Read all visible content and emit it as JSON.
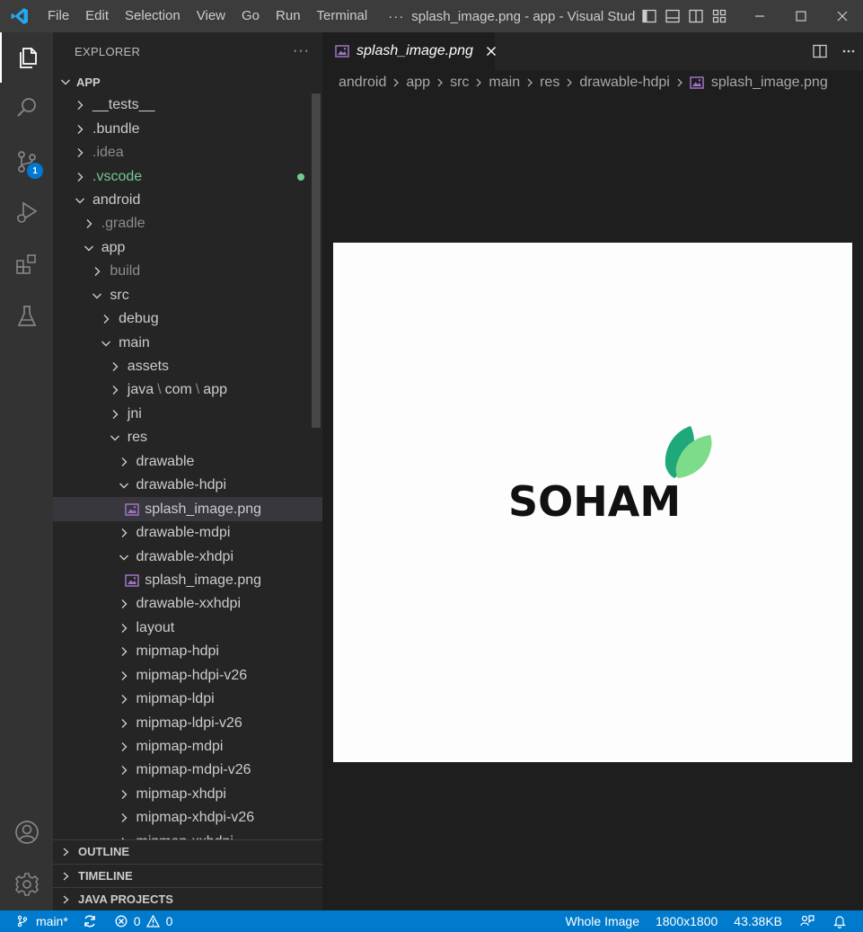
{
  "titlebar": {
    "menu": [
      "File",
      "Edit",
      "Selection",
      "View",
      "Go",
      "Run",
      "Terminal"
    ],
    "more": "···",
    "title": "splash_image.png - app - Visual Studi..."
  },
  "activity": {
    "scm_badge": "1"
  },
  "sidebar": {
    "header": "EXPLORER",
    "header_more": "···",
    "root": "APP",
    "tree": [
      {
        "label": "__tests__",
        "depth": 0,
        "type": "folder",
        "open": false
      },
      {
        "label": ".bundle",
        "depth": 0,
        "type": "folder",
        "open": false
      },
      {
        "label": ".idea",
        "depth": 0,
        "type": "folder",
        "open": false,
        "dim": true
      },
      {
        "label": ".vscode",
        "depth": 0,
        "type": "folder",
        "open": false,
        "git": true
      },
      {
        "label": "android",
        "depth": 0,
        "type": "folder",
        "open": true
      },
      {
        "label": ".gradle",
        "depth": 1,
        "type": "folder",
        "open": false,
        "dim": true
      },
      {
        "label": "app",
        "depth": 1,
        "type": "folder",
        "open": true
      },
      {
        "label": "build",
        "depth": 2,
        "type": "folder",
        "open": false,
        "dim": true
      },
      {
        "label": "src",
        "depth": 2,
        "type": "folder",
        "open": true
      },
      {
        "label": "debug",
        "depth": 3,
        "type": "folder",
        "open": false
      },
      {
        "label": "main",
        "depth": 3,
        "type": "folder",
        "open": true
      },
      {
        "label": "assets",
        "depth": 4,
        "type": "folder",
        "open": false
      },
      {
        "label": "java",
        "compact": [
          "com",
          "app"
        ],
        "depth": 4,
        "type": "folder",
        "open": false
      },
      {
        "label": "jni",
        "depth": 4,
        "type": "folder",
        "open": false
      },
      {
        "label": "res",
        "depth": 4,
        "type": "folder",
        "open": true
      },
      {
        "label": "drawable",
        "depth": 5,
        "type": "folder",
        "open": false
      },
      {
        "label": "drawable-hdpi",
        "depth": 5,
        "type": "folder",
        "open": true
      },
      {
        "label": "splash_image.png",
        "depth": 6,
        "type": "image",
        "selected": true
      },
      {
        "label": "drawable-mdpi",
        "depth": 5,
        "type": "folder",
        "open": false
      },
      {
        "label": "drawable-xhdpi",
        "depth": 5,
        "type": "folder",
        "open": true
      },
      {
        "label": "splash_image.png",
        "depth": 6,
        "type": "image"
      },
      {
        "label": "drawable-xxhdpi",
        "depth": 5,
        "type": "folder",
        "open": false
      },
      {
        "label": "layout",
        "depth": 5,
        "type": "folder",
        "open": false
      },
      {
        "label": "mipmap-hdpi",
        "depth": 5,
        "type": "folder",
        "open": false
      },
      {
        "label": "mipmap-hdpi-v26",
        "depth": 5,
        "type": "folder",
        "open": false
      },
      {
        "label": "mipmap-ldpi",
        "depth": 5,
        "type": "folder",
        "open": false
      },
      {
        "label": "mipmap-ldpi-v26",
        "depth": 5,
        "type": "folder",
        "open": false
      },
      {
        "label": "mipmap-mdpi",
        "depth": 5,
        "type": "folder",
        "open": false
      },
      {
        "label": "mipmap-mdpi-v26",
        "depth": 5,
        "type": "folder",
        "open": false
      },
      {
        "label": "mipmap-xhdpi",
        "depth": 5,
        "type": "folder",
        "open": false
      },
      {
        "label": "mipmap-xhdpi-v26",
        "depth": 5,
        "type": "folder",
        "open": false
      },
      {
        "label": "mipmap-xxhdpi",
        "depth": 5,
        "type": "folder",
        "open": false
      }
    ],
    "sections": [
      "OUTLINE",
      "TIMELINE",
      "JAVA PROJECTS"
    ]
  },
  "editor": {
    "tab_label": "splash_image.png",
    "breadcrumb": [
      "android",
      "app",
      "src",
      "main",
      "res",
      "drawable-hdpi"
    ],
    "breadcrumb_file": "splash_image.png",
    "logo_text": "SOHAM"
  },
  "statusbar": {
    "branch": "main*",
    "errors": "0",
    "warnings": "0",
    "zoom": "Whole Image",
    "dimensions": "1800x1800",
    "size": "43.38KB"
  },
  "colors": {
    "accent": "#007acc",
    "git_added": "#73c991",
    "leaf_dark": "#1fa97a",
    "leaf_light": "#7ddc8a"
  }
}
